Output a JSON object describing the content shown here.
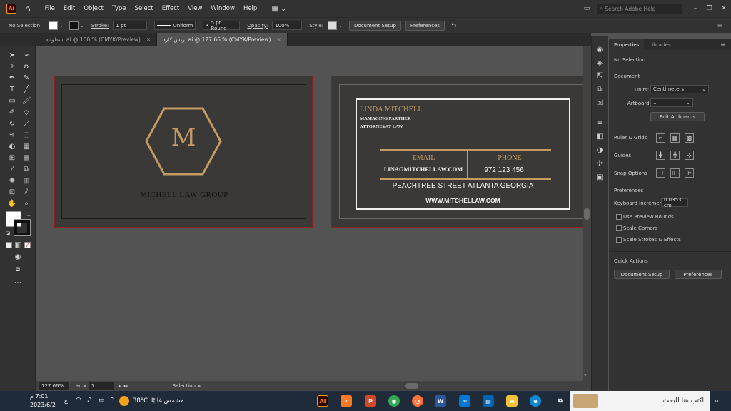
{
  "menubar": {
    "app_logo": "Ai",
    "menus": [
      "File",
      "Edit",
      "Object",
      "Type",
      "Select",
      "Effect",
      "View",
      "Window",
      "Help"
    ],
    "search_placeholder": "Search Adobe Help"
  },
  "control_bar": {
    "selection": "No Selection",
    "stroke_label": "Stroke:",
    "stroke_value": "1 pt",
    "profile": "Uniform",
    "brush": "5 pt. Round",
    "opacity_label": "Opacity:",
    "opacity_value": "100%",
    "style_label": "Style:",
    "document_setup": "Document Setup",
    "preferences": "Preferences"
  },
  "tabs": [
    {
      "label": "اسطوانة.ai @ 100 % (CMYK/Preview)",
      "active": false
    },
    {
      "label": "بزنس كارد.ai @ 127.66 % (CMYK/Preview)",
      "active": true
    }
  ],
  "artboard_front": {
    "monogram": "M",
    "company": "MICHELL LAW GROUP",
    "gold": "#c49a63"
  },
  "artboard_back": {
    "name": "LINDA  MITCHELL",
    "title_line1": "MAMAGING PARTHER",
    "title_line2": "ATTORNEYAT LAW",
    "email_label": "EMAIL",
    "email_value": "LINAGMITCHELLAW.COM",
    "phone_label": "PHONE",
    "phone_value": "972 123 456",
    "address": "PEACHTREE STREET ATLANTA GEORGIA",
    "website": "WWW.MITCHELLAW.COM"
  },
  "status": {
    "zoom": "127.66%",
    "artboard": "1",
    "tool": "Selection"
  },
  "properties": {
    "tab_properties": "Properties",
    "tab_libraries": "Libraries",
    "no_selection": "No Selection",
    "document": "Document",
    "units_label": "Units:",
    "units_value": "Centimeters",
    "artboard_label": "Artboard:",
    "artboard_value": "1",
    "edit_artboards": "Edit Artboards",
    "rulers_grids": "Ruler & Grids",
    "guides": "Guides",
    "snap_options": "Snap Options",
    "preferences": "Preferences",
    "keyboard_increment_label": "Keyboard Increment:",
    "keyboard_increment_value": "0.0353 cm",
    "use_preview_bounds": "Use Preview Bounds",
    "scale_corners": "Scale Corners",
    "scale_strokes": "Scale Strokes & Effects",
    "quick_actions": "Quick Actions",
    "qa_document_setup": "Document Setup",
    "qa_preferences": "Preferences"
  },
  "taskbar": {
    "search_text": "اكتب هنا للبحث",
    "weather_temp": "38°C",
    "weather_text": "مشمس غالبًا",
    "time": "7:01 م",
    "date": "2023/6/2",
    "lang": "ع"
  }
}
